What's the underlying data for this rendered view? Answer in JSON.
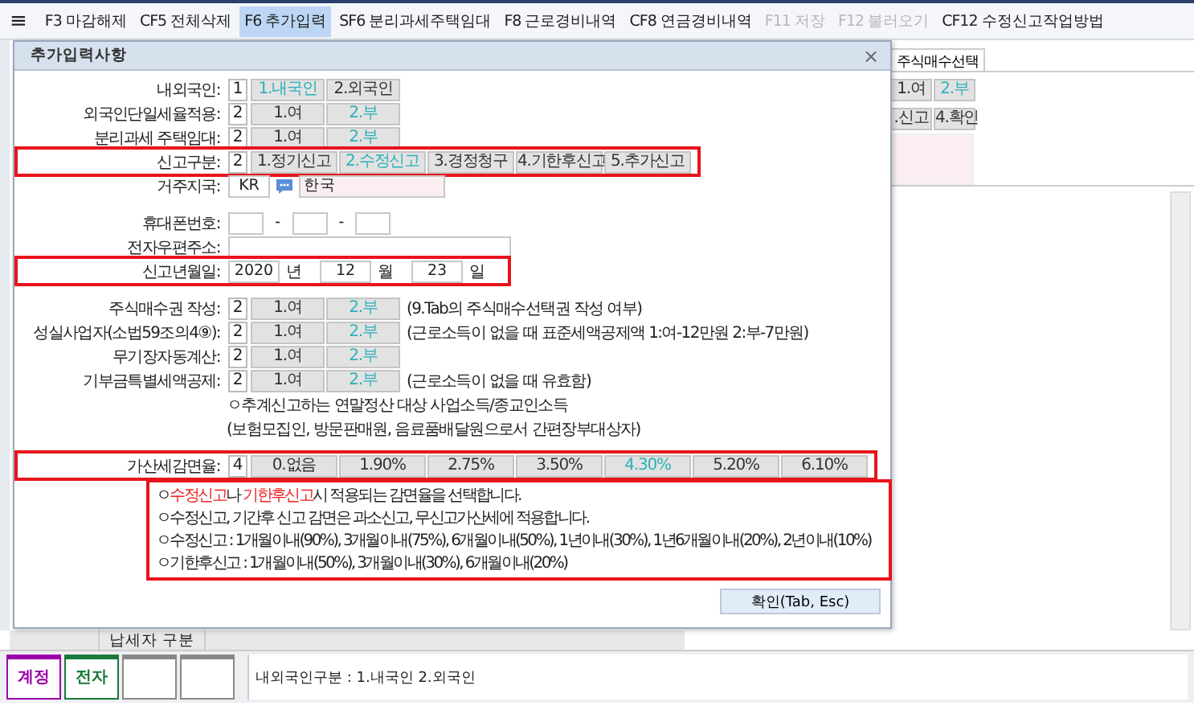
{
  "toolbar": {
    "menu_icon": "≡",
    "items": [
      {
        "label": "F3 마감해제",
        "selected": false,
        "disabled": false
      },
      {
        "label": "CF5 전체삭제",
        "selected": false,
        "disabled": false
      },
      {
        "label": "F6 추가입력",
        "selected": true,
        "disabled": false
      },
      {
        "label": "SF6 분리과세주택임대",
        "selected": false,
        "disabled": false
      },
      {
        "label": "F8 근로경비내역",
        "selected": false,
        "disabled": false
      },
      {
        "label": "CF8 연금경비내역",
        "selected": false,
        "disabled": false
      },
      {
        "label": "F11 저장",
        "selected": false,
        "disabled": true
      },
      {
        "label": "F12 불러오기",
        "selected": false,
        "disabled": true
      },
      {
        "label": "CF12 수정신고작업방법",
        "selected": false,
        "disabled": false
      }
    ]
  },
  "background": {
    "tab": "주식매수선택",
    "option_rows": [
      [
        {
          "label": "1.여",
          "selected": false
        },
        {
          "label": "2.부",
          "selected": true
        }
      ],
      [
        {
          "label": ".신고",
          "selected": false
        },
        {
          "label": "4.확인",
          "selected": false
        }
      ]
    ],
    "bottom_headers": [
      "납세자 구분"
    ]
  },
  "dialog": {
    "title": "추가입력사항",
    "close": "×",
    "rows": [
      {
        "kind": "options",
        "label": "내외국인:",
        "code": "1",
        "highlighted": false,
        "options": [
          {
            "label": "1.내국인",
            "selected": true
          },
          {
            "label": "2.외국인",
            "selected": false
          }
        ]
      },
      {
        "kind": "options",
        "label": "외국인단일세율적용:",
        "code": "2",
        "highlighted": false,
        "options": [
          {
            "label": "1.여",
            "selected": false
          },
          {
            "label": "2.부",
            "selected": true
          }
        ]
      },
      {
        "kind": "options",
        "label": "분리과세 주택임대:",
        "code": "2",
        "highlighted": false,
        "options": [
          {
            "label": "1.여",
            "selected": false
          },
          {
            "label": "2.부",
            "selected": true
          }
        ]
      },
      {
        "kind": "options",
        "label": "신고구분:",
        "code": "2",
        "highlighted": true,
        "options": [
          {
            "label": "1.정기신고",
            "selected": false
          },
          {
            "label": "2.수정신고",
            "selected": true
          },
          {
            "label": "3.경정청구",
            "selected": false
          },
          {
            "label": "4.기한후신고",
            "selected": false
          },
          {
            "label": "5.추가신고",
            "selected": false
          }
        ]
      },
      {
        "kind": "country",
        "label": "거주지국:",
        "code": "KR",
        "name": "한국"
      },
      {
        "kind": "gap"
      },
      {
        "kind": "phone",
        "label": "휴대폰번호:",
        "separators": [
          "-",
          "-"
        ]
      },
      {
        "kind": "email",
        "label": "전자우편주소:"
      },
      {
        "kind": "date",
        "label": "신고년월일:",
        "highlighted": true,
        "parts": [
          {
            "value": "2020",
            "unit": "년"
          },
          {
            "value": "12",
            "unit": "월"
          },
          {
            "value": "23",
            "unit": "일"
          }
        ]
      },
      {
        "kind": "gap"
      },
      {
        "kind": "options",
        "label": "주식매수권 작성:",
        "code": "2",
        "highlighted": false,
        "options": [
          {
            "label": "1.여",
            "selected": false
          },
          {
            "label": "2.부",
            "selected": true
          }
        ],
        "note": "(9.Tab의 주식매수선택권 작성 여부)"
      },
      {
        "kind": "options",
        "label": "성실사업자(소법59조의4⑨):",
        "code": "2",
        "highlighted": false,
        "options": [
          {
            "label": "1.여",
            "selected": false
          },
          {
            "label": "2.부",
            "selected": true
          }
        ],
        "note": "(근로소득이 없을 때 표준세액공제액 1:여-12만원 2:부-7만원)"
      },
      {
        "kind": "options",
        "label": "무기장자동계산:",
        "code": "2",
        "highlighted": false,
        "options": [
          {
            "label": "1.여",
            "selected": false
          },
          {
            "label": "2.부",
            "selected": true
          }
        ]
      },
      {
        "kind": "options",
        "label": "기부금특별세액공제:",
        "code": "2",
        "highlighted": false,
        "options": [
          {
            "label": "1.여",
            "selected": false
          },
          {
            "label": "2.부",
            "selected": true
          }
        ],
        "note": "(근로소득이 없을 때 유효함)"
      },
      {
        "kind": "text",
        "text": "ㅇ추계신고하는 연말정산 대상 사업소득/종교인소득"
      },
      {
        "kind": "text",
        "text": "(보험모집인, 방문판매원, 음료품배달원으로서 간편장부대상자)"
      },
      {
        "kind": "gap"
      },
      {
        "kind": "options",
        "label": "가산세감면율:",
        "code": "4",
        "highlighted": true,
        "options": [
          {
            "label": "0.없음",
            "selected": false
          },
          {
            "label": "1.90%",
            "selected": false
          },
          {
            "label": "2.75%",
            "selected": false
          },
          {
            "label": "3.50%",
            "selected": false
          },
          {
            "label": "4.30%",
            "selected": true
          },
          {
            "label": "5.20%",
            "selected": false
          },
          {
            "label": "6.10%",
            "selected": false
          }
        ]
      }
    ],
    "notes": [
      [
        {
          "text": "ㅇ",
          "emphasis": false
        },
        {
          "text": "수정신고",
          "emphasis": true
        },
        {
          "text": "나 ",
          "emphasis": false
        },
        {
          "text": "기한후신고",
          "emphasis": true
        },
        {
          "text": "시 적용되는 감면율을 선택합니다.",
          "emphasis": false
        }
      ],
      [
        {
          "text": "ㅇ수정신고, 기간후 신고 감면은 과소신고, 무신고가산세에 적용합니다.",
          "emphasis": false
        }
      ],
      [
        {
          "text": "ㅇ수정신고 : 1개월이내(90%), 3개월이내(75%), 6개월이내(50%), 1년이내(30%), 1년6개월이내(20%), 2년이내(10%)",
          "emphasis": false
        }
      ],
      [
        {
          "text": "ㅇ기한후신고 : 1개월이내(50%), 3개월이내(30%), 6개월이내(20%)",
          "emphasis": false
        }
      ]
    ],
    "confirm": "확인(Tab, Esc)"
  },
  "status_bar": {
    "buttons": [
      {
        "label": "계정",
        "color": "#9c00a8"
      },
      {
        "label": "전자",
        "color": "#1a7a3a"
      },
      {
        "color": "#888888"
      },
      {
        "color": "#888888"
      }
    ],
    "message": "내외국인구분 : 1.내국인 2.외국인"
  }
}
